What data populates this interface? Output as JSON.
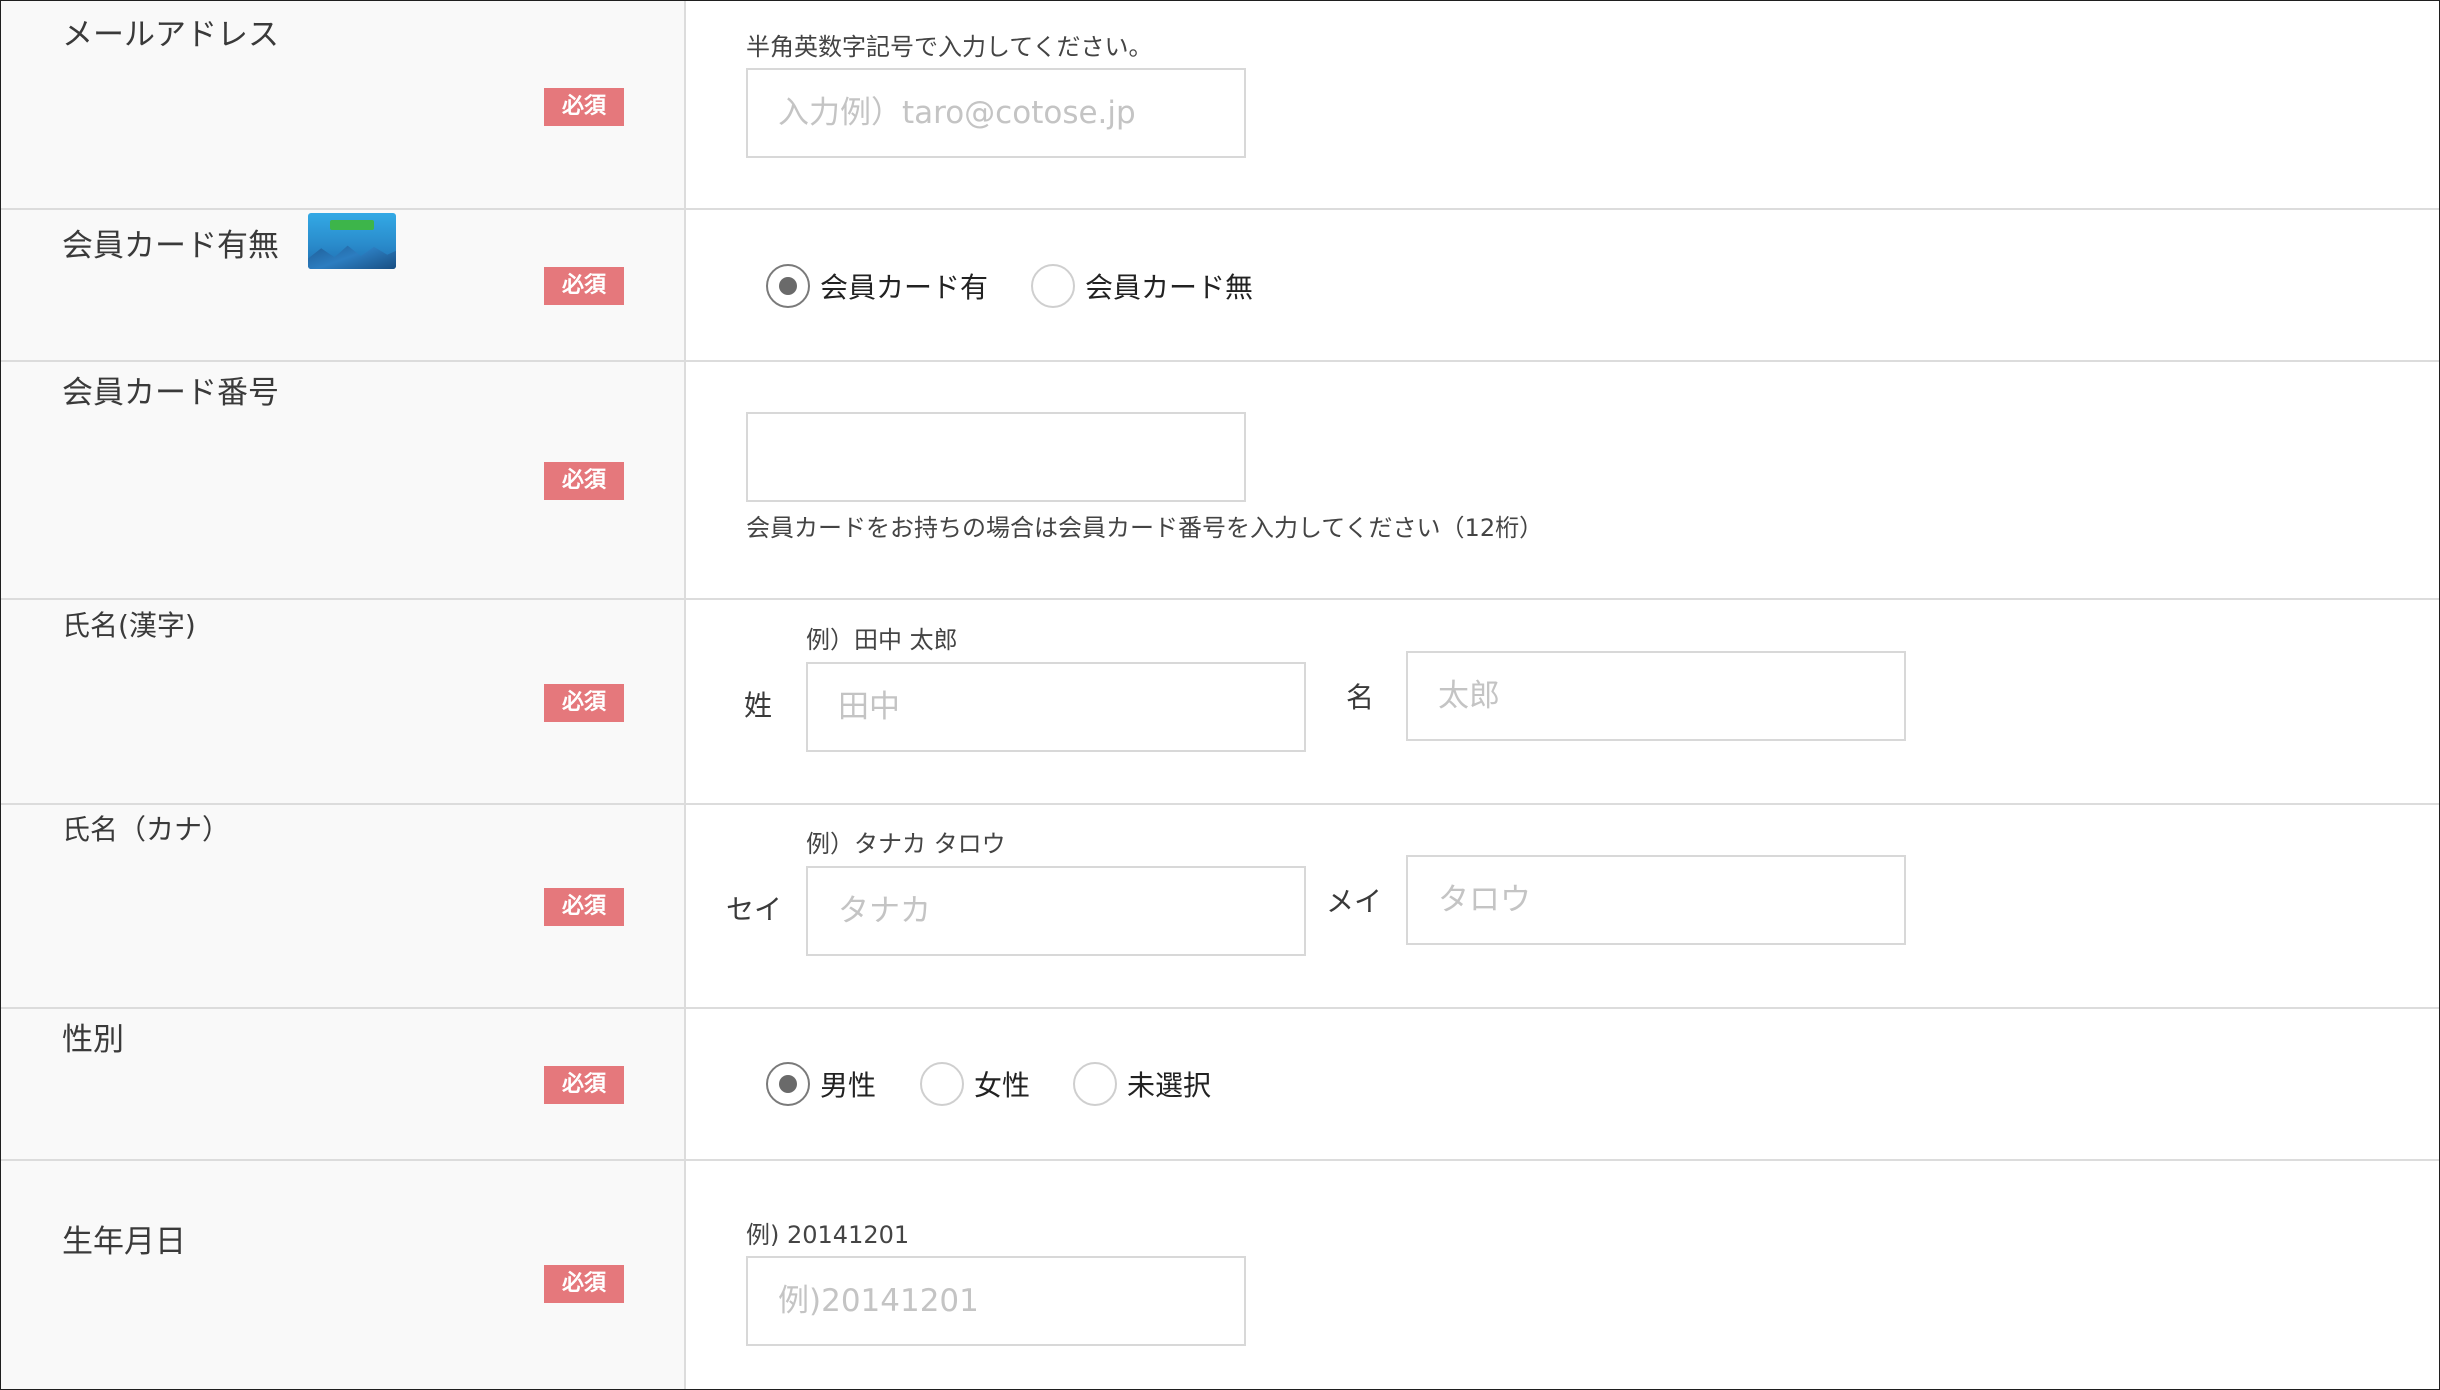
{
  "required_label": "必須",
  "colors": {
    "required_badge": "#e5787c",
    "label_background": "#f9f9f9",
    "border": "#dcdcdc",
    "placeholder": "#c4c4c4"
  },
  "email": {
    "label": "メールアドレス",
    "note": "半角英数字記号で入力してください。",
    "placeholder": "入力例）taro@cotose.jp",
    "value": ""
  },
  "member_card": {
    "label": "会員カード有無",
    "card_image": "member-card-image",
    "options": [
      {
        "label": "会員カード有",
        "selected": true
      },
      {
        "label": "会員カード無",
        "selected": false
      }
    ]
  },
  "card_number": {
    "label": "会員カード番号",
    "value": "",
    "note": "会員カードをお持ちの場合は会員カード番号を入力してください（12桁）"
  },
  "name_kanji": {
    "label": "氏名(漢字)",
    "example": "例）田中 太郎",
    "last": {
      "label": "姓",
      "placeholder": "田中",
      "value": ""
    },
    "first": {
      "label": "名",
      "placeholder": "太郎",
      "value": ""
    }
  },
  "name_kana": {
    "label": "氏名（カナ）",
    "example": "例）タナカ タロウ",
    "last": {
      "label": "セイ",
      "placeholder": "タナカ",
      "value": ""
    },
    "first": {
      "label": "メイ",
      "placeholder": "タロウ",
      "value": ""
    }
  },
  "gender": {
    "label": "性別",
    "options": [
      {
        "label": "男性",
        "selected": true
      },
      {
        "label": "女性",
        "selected": false
      },
      {
        "label": "未選択",
        "selected": false
      }
    ]
  },
  "birthdate": {
    "label": "生年月日",
    "example": "例) 20141201",
    "placeholder": "例)20141201",
    "value": ""
  }
}
